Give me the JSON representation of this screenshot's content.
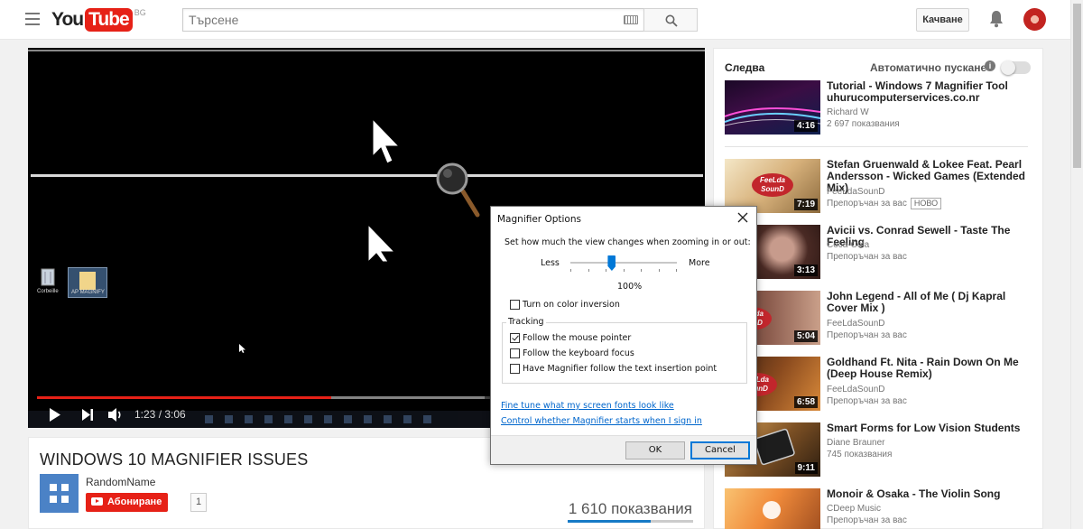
{
  "masthead": {
    "logo_you": "You",
    "logo_tube": "Tube",
    "logo_country": "BG",
    "search_placeholder": "Търсене",
    "upload_label": "Качване"
  },
  "player": {
    "time": "1:23 / 3:06",
    "played_fraction": 0.446,
    "loaded_fraction": 0.68
  },
  "video": {
    "title": "WINDOWS 10 MAGNIFIER ISSUES",
    "channel": "RandomName",
    "subscribe_label": "Абониране",
    "subscriber_count": "1",
    "views": "1 610 показвания",
    "like_ratio": 0.66
  },
  "sidebar": {
    "up_next": "Следва",
    "autoplay_label": "Автоматично пускане",
    "items": [
      {
        "title": "Tutorial - Windows 7 Magnifier Tool uhurucomputerservices.co.nr",
        "channel": "Richard W",
        "meta": "2 697 показвания",
        "duration": "4:16"
      },
      {
        "title": "Stefan Gruenwald & Lokee Feat. Pearl Andersson - Wicked Games (Extended Mix)",
        "channel": "FeeLdaSounD",
        "meta": "Препоръчан за вас",
        "badge": "НОВО",
        "duration": "7:19"
      },
      {
        "title": "Avicii vs. Conrad Sewell - Taste The Feeling",
        "channel": "Coca-Cola",
        "meta": "Препоръчан за вас",
        "duration": "3:13"
      },
      {
        "title": "John Legend - All of Me ( Dj Kapral Cover Mix )",
        "channel": "FeeLdaSounD",
        "meta": "Препоръчан за вас",
        "duration": "5:04"
      },
      {
        "title": "Goldhand Ft. Nita - Rain Down On Me (Deep House Remix)",
        "channel": "FeeLdaSounD",
        "meta": "Препоръчан за вас",
        "duration": "6:58"
      },
      {
        "title": "Smart Forms for Low Vision Students",
        "channel": "Diane Brauner",
        "meta": "745 показвания",
        "duration": "9:11"
      },
      {
        "title": "Monoir & Osaka - The Violin Song",
        "channel": "CDeep Music",
        "meta": "Препоръчан за вас",
        "duration": ""
      }
    ]
  },
  "dialog": {
    "title": "Magnifier Options",
    "zoom_prompt": "Set how much the view changes when zooming in or out:",
    "less": "Less",
    "more": "More",
    "percent": "100%",
    "slider_value": 0.38,
    "color_inversion": "Turn on color inversion",
    "tracking": "Tracking",
    "follow_mouse": "Follow the mouse pointer",
    "follow_keyboard": "Follow the keyboard focus",
    "follow_text": "Have Magnifier follow the text insertion point",
    "link_fonts": "Fine tune what my screen fonts look like",
    "link_startup": "Control whether Magnifier starts when I sign in",
    "ok": "OK",
    "cancel": "Cancel"
  },
  "desktop": {
    "recycle_label": "Corbeille",
    "folder_label": "AP MAGNIFY"
  }
}
